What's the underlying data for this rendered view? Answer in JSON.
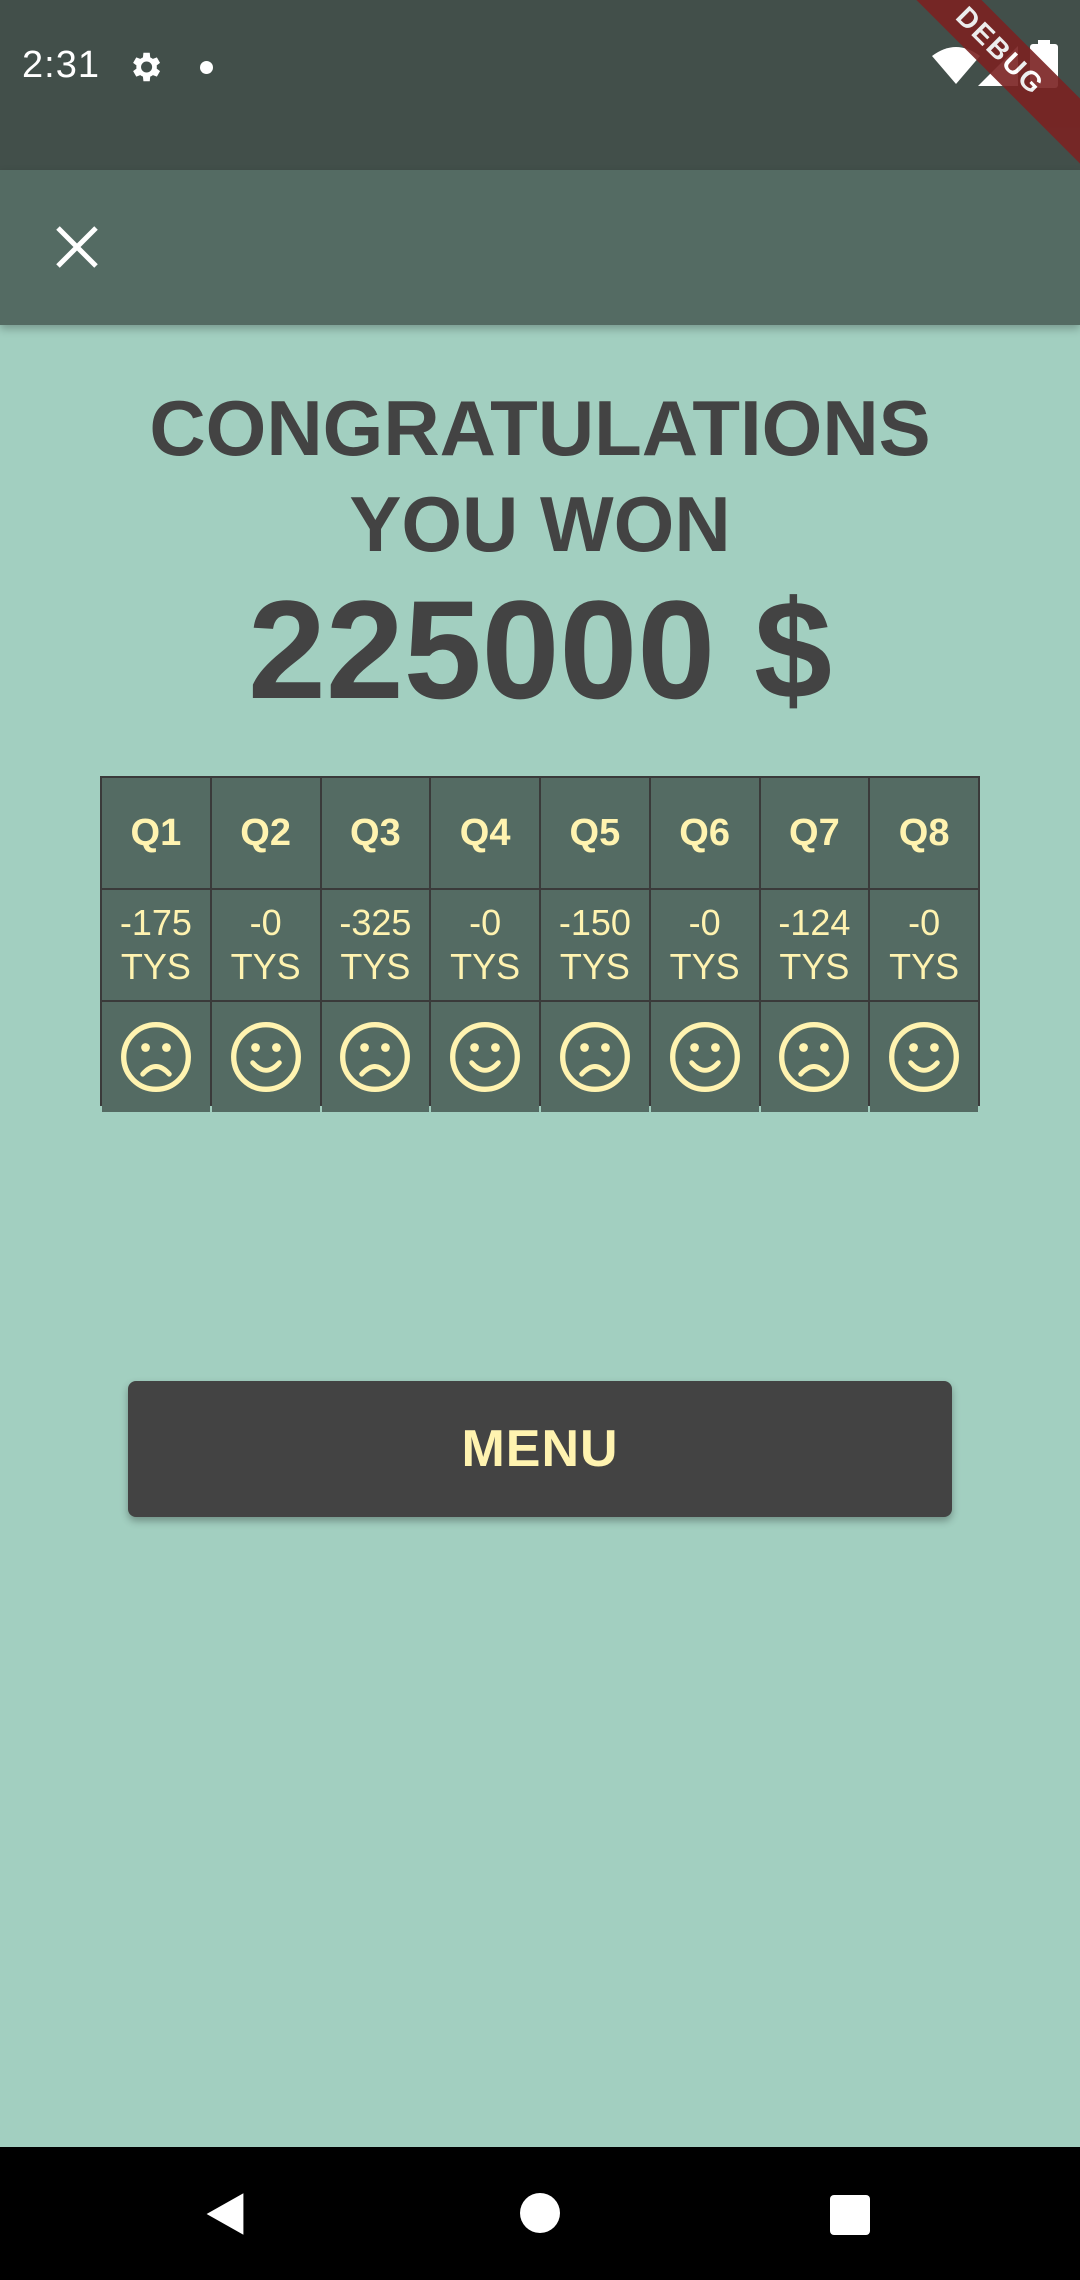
{
  "status_bar": {
    "time": "2:31",
    "icons": [
      "gear-icon",
      "notification-dot-icon",
      "wifi-icon",
      "signal-icon",
      "battery-icon"
    ]
  },
  "debug_banner": "DEBUG",
  "app_bar": {
    "close_icon": "close-icon"
  },
  "headline": {
    "line1": "CONGRATULATIONS",
    "line2": "YOU WON"
  },
  "amount": "225000 $",
  "results": [
    {
      "question": "Q1",
      "score_value": "-175",
      "score_unit": "TYS",
      "mood": "sad"
    },
    {
      "question": "Q2",
      "score_value": "-0",
      "score_unit": "TYS",
      "mood": "happy"
    },
    {
      "question": "Q3",
      "score_value": "-325",
      "score_unit": "TYS",
      "mood": "sad"
    },
    {
      "question": "Q4",
      "score_value": "-0",
      "score_unit": "TYS",
      "mood": "happy"
    },
    {
      "question": "Q5",
      "score_value": "-150",
      "score_unit": "TYS",
      "mood": "sad"
    },
    {
      "question": "Q6",
      "score_value": "-0",
      "score_unit": "TYS",
      "mood": "happy"
    },
    {
      "question": "Q7",
      "score_value": "-124",
      "score_unit": "TYS",
      "mood": "sad"
    },
    {
      "question": "Q8",
      "score_value": "-0",
      "score_unit": "TYS",
      "mood": "happy"
    }
  ],
  "menu_button": "MENU",
  "colors": {
    "background": "#a2cfc0",
    "status_bar": "#424f4a",
    "app_bar": "#546b63",
    "table_cell": "#546b63",
    "accent_text": "#fff3b0",
    "dark_text": "#434343"
  }
}
